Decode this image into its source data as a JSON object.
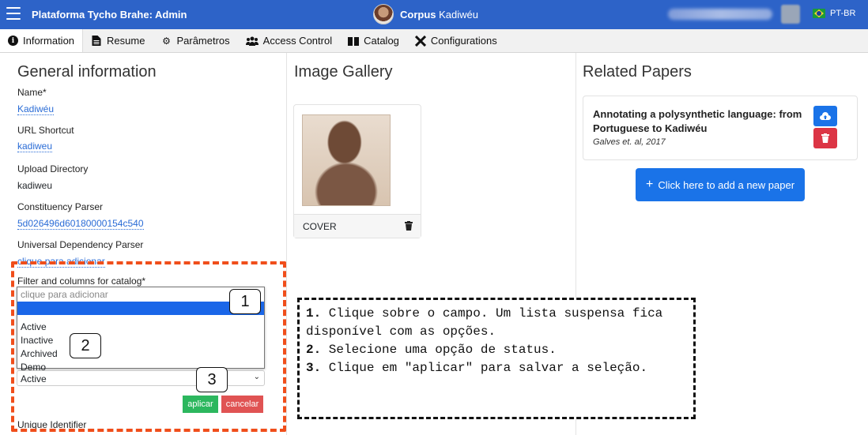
{
  "topbar": {
    "app_title": "Plataforma Tycho Brahe: Admin",
    "corpus_prefix": "Corpus",
    "corpus_name": "Kadiwéu",
    "language": "PT-BR",
    "color": "#2d63c8"
  },
  "tabs": [
    {
      "label": "Information",
      "icon": "info-icon"
    },
    {
      "label": "Resume",
      "icon": "file-icon"
    },
    {
      "label": "Parâmetros",
      "icon": "cogs-icon"
    },
    {
      "label": "Access Control",
      "icon": "users-icon"
    },
    {
      "label": "Catalog",
      "icon": "book-icon"
    },
    {
      "label": "Configurations",
      "icon": "tools-icon"
    }
  ],
  "general": {
    "title": "General information",
    "fields": [
      {
        "label": "Name*",
        "value": "Kadiwéu"
      },
      {
        "label": "URL Shortcut",
        "value": "kadiweu"
      },
      {
        "label": "Upload Directory",
        "value": "kadiweu"
      },
      {
        "label": "Constituency Parser",
        "value": "5d026496d60180000154c540"
      },
      {
        "label": "Universal Dependency Parser",
        "value": "clique para adicionar"
      }
    ],
    "filter_label": "Filter and columns for catalog*",
    "dropdown": {
      "placeholder": "clique para adicionar",
      "options": [
        "",
        "Active",
        "Inactive",
        "Archived",
        "Demo"
      ]
    },
    "select_value": "Active",
    "apply_label": "aplicar",
    "cancel_label": "cancelar",
    "unique_identifier_label": "Unique Identifier"
  },
  "gallery": {
    "title": "Image Gallery",
    "cover_label": "COVER"
  },
  "papers": {
    "title": "Related Papers",
    "items": [
      {
        "title": "Annotating a polysynthetic language: from Portuguese to Kadiwéu",
        "meta": "Galves et. al, 2017"
      }
    ],
    "add_label": "Click here to add a new paper"
  },
  "annotations": {
    "steps": [
      "1",
      "2",
      "3"
    ],
    "instructions": [
      {
        "num": "1.",
        "text": " Clique sobre o campo. Um lista suspensa fica disponível com as opções."
      },
      {
        "num": "2.",
        "text": " Selecione uma opção de status."
      },
      {
        "num": "3.",
        "text": " Clique em \"aplicar\" para salvar a seleção."
      }
    ],
    "highlight_color": "#f04e1b"
  }
}
